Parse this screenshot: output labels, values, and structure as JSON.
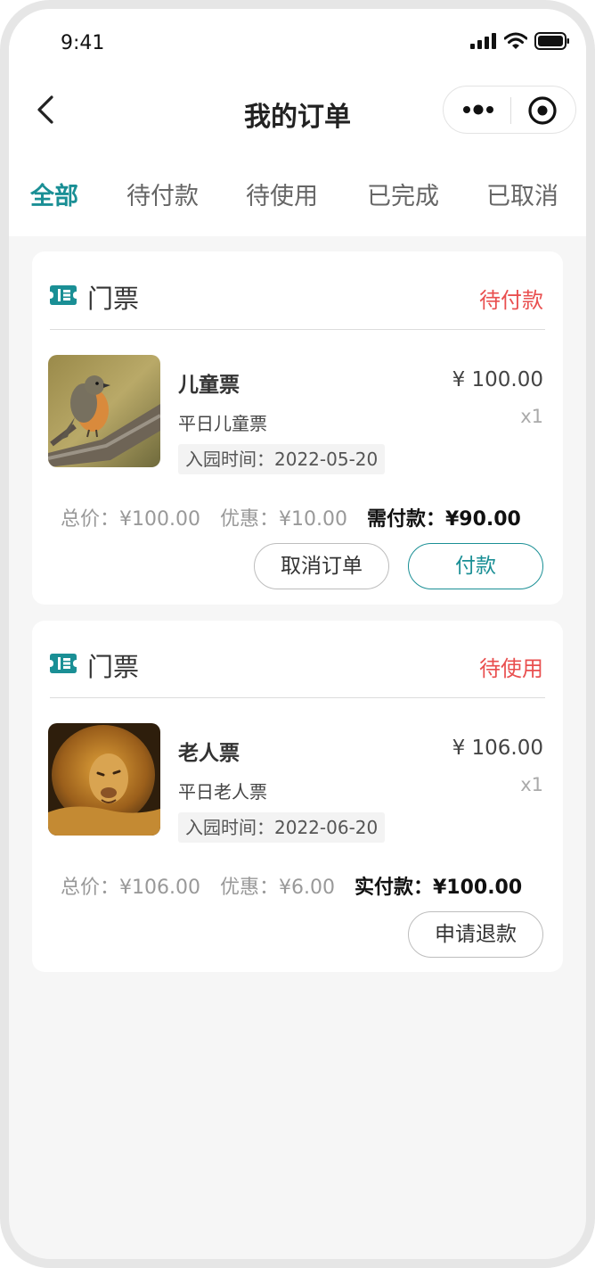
{
  "status_bar": {
    "time": "9:41"
  },
  "nav": {
    "title": "我的订单"
  },
  "tabs": [
    "全部",
    "待付款",
    "待使用",
    "已完成",
    "已取消"
  ],
  "colors": {
    "accent": "#1a8f95",
    "status_red": "#e94f4f",
    "background": "#f6f6f6"
  },
  "orders": [
    {
      "category_icon": "ticket-icon",
      "category": "门票",
      "status": "待付款",
      "item": {
        "name": "儿童票",
        "price": "¥ 100.00",
        "subtitle": "平日儿童票",
        "quantity": "x1",
        "entry_date": "入园时间：2022-05-20",
        "thumbnail": "bird-photo"
      },
      "total": "总价：¥100.00",
      "discount": "优惠：¥10.00",
      "payable": "需付款：¥90.00",
      "buttons": {
        "cancel": "取消订单",
        "pay": "付款"
      }
    },
    {
      "category_icon": "ticket-icon",
      "category": "门票",
      "status": "待使用",
      "item": {
        "name": "老人票",
        "price": "¥ 106.00",
        "subtitle": "平日老人票",
        "quantity": "x1",
        "entry_date": "入园时间：2022-06-20",
        "thumbnail": "lion-photo"
      },
      "total": "总价：¥106.00",
      "discount": "优惠：¥6.00",
      "payable": "实付款：¥100.00",
      "buttons": {
        "refund": "申请退款"
      }
    }
  ]
}
